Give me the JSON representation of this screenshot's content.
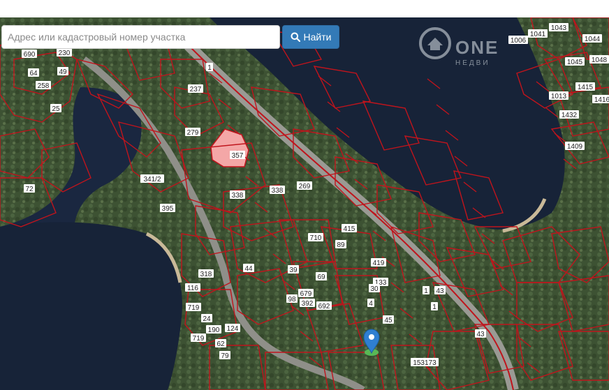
{
  "search": {
    "placeholder": "Адрес или кадастровый номер участка",
    "value": "",
    "button_label": "Найти"
  },
  "watermark": {
    "title": "ONE",
    "subtitle": "НЕДВИ"
  },
  "plot_labels": [
    "690",
    "230",
    "64",
    "49",
    "258",
    "25",
    "72",
    "279",
    "357",
    "338",
    "338",
    "341/2",
    "395",
    "269",
    "415",
    "419",
    "710",
    "89",
    "44",
    "39",
    "69",
    "318",
    "116",
    "719",
    "679",
    "392",
    "692",
    "98",
    "24",
    "190",
    "124",
    "719",
    "62",
    "79",
    "1",
    "1",
    "43",
    "43",
    "133",
    "30",
    "4",
    "45",
    "153173",
    "237",
    "1",
    "1041",
    "1043",
    "1006",
    "1044",
    "1045",
    "1048",
    "1013",
    "1415",
    "1416",
    "1432",
    "1409"
  ],
  "colors": {
    "parcel_line": "#c0141c",
    "selected_parcel": "#f4a7a7",
    "water": "#162238",
    "button": "#337ab7",
    "marker": "#2f7fd1"
  },
  "icons": {
    "search_button": "search-icon",
    "marker": "map-marker-icon"
  }
}
